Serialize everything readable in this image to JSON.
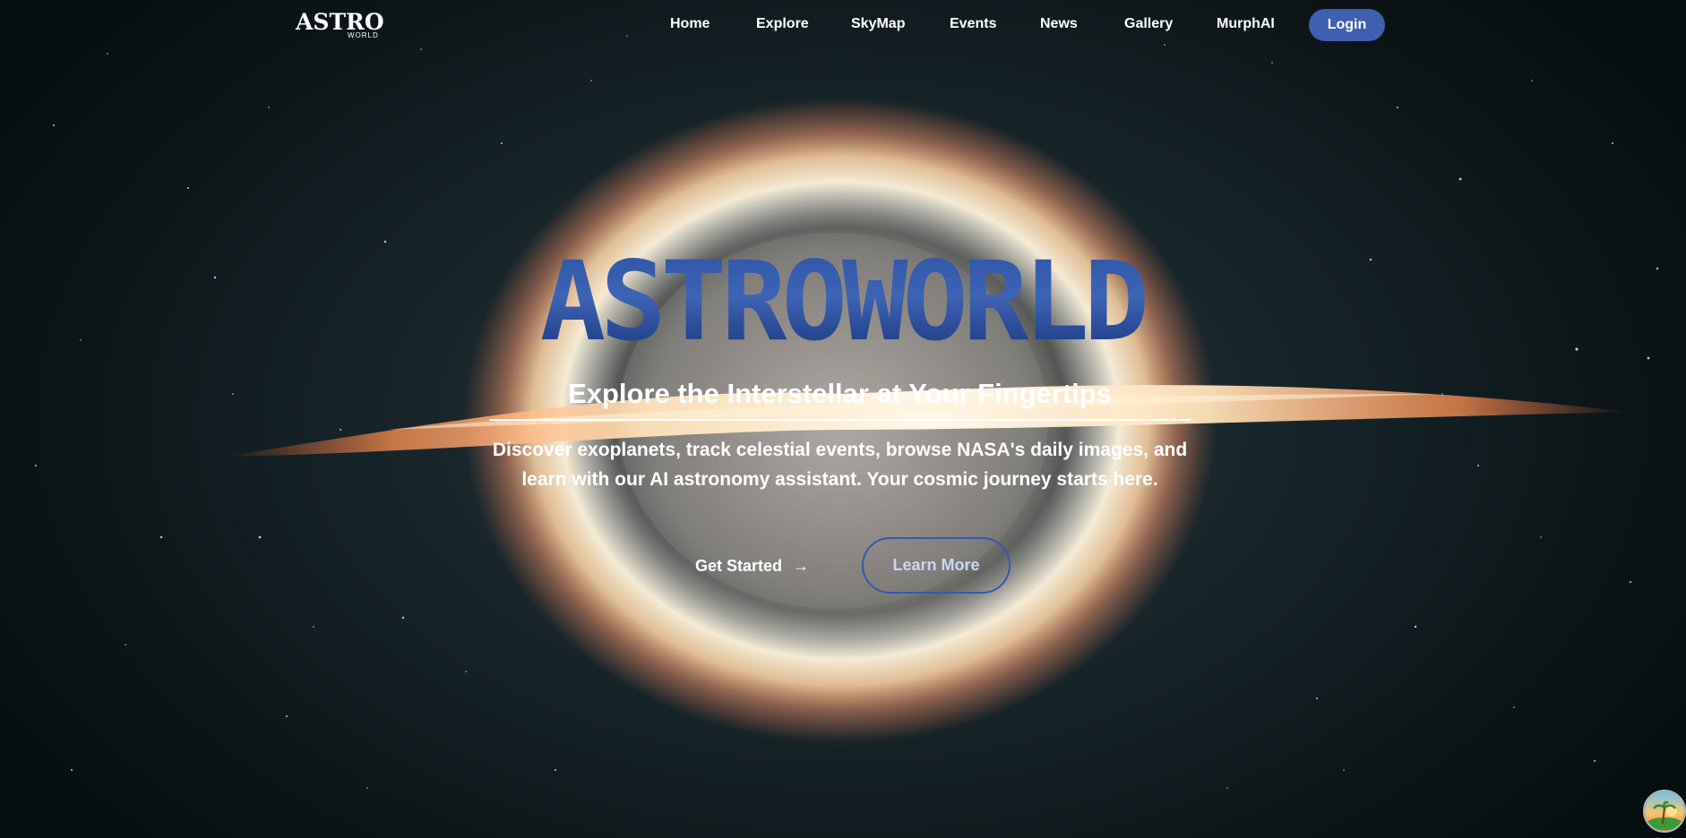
{
  "brand": {
    "logo_main": "ASTRO",
    "logo_sub": "WORLD"
  },
  "nav": {
    "links": [
      {
        "label": "Home"
      },
      {
        "label": "Explore"
      },
      {
        "label": "SkyMap"
      },
      {
        "label": "Events"
      },
      {
        "label": "News"
      },
      {
        "label": "Gallery"
      },
      {
        "label": "MurphAI"
      }
    ],
    "login_label": "Login"
  },
  "hero": {
    "title": "ASTROWORLD",
    "subtitle": "Explore the Interstellar at Your Fingertips",
    "description": "Discover exoplanets, track celestial events, browse NASA's daily images, and learn with our AI astronomy assistant. Your cosmic journey starts here.",
    "primary_cta": "Get Started",
    "primary_cta_icon": "→",
    "secondary_cta": "Learn More"
  },
  "colors": {
    "accent": "#3f5fb0",
    "title_blue": "#2e56a8",
    "background": "#0b1416"
  }
}
